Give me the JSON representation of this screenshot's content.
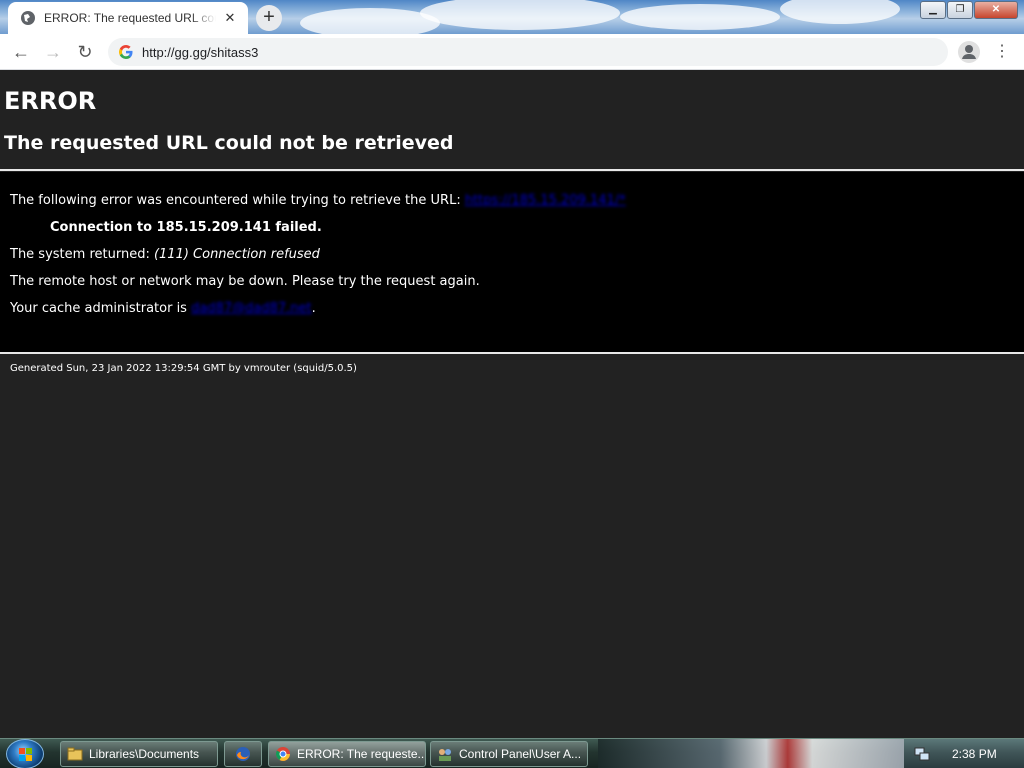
{
  "browser": {
    "tab": {
      "title": "ERROR: The requested URL could not be retrieved",
      "close": "✕"
    },
    "new_tab": "+",
    "window_controls": {
      "minimize": "▁",
      "restore": "❐",
      "close": "✕"
    },
    "toolbar": {
      "back": "←",
      "forward": "→",
      "reload": "↻",
      "menu": "⋮"
    },
    "address_bar": {
      "url": "http://gg.gg/shitass3"
    }
  },
  "page": {
    "heading": "ERROR",
    "subheading": "The requested URL could not be retrieved",
    "error_intro": "The following error was encountered while trying to retrieve the URL: ",
    "error_url": "https://185.15.209.141/*",
    "connection_failed": "Connection to 185.15.209.141 failed.",
    "system_returned_label": "The system returned: ",
    "system_returned_value": "(111) Connection refused",
    "remote_host_msg": "The remote host or network may be down. Please try the request again.",
    "admin_label": "Your cache administrator is ",
    "admin_email": "dad87@dad87.net",
    "admin_suffix": ".",
    "footer": "Generated Sun, 23 Jan 2022 13:29:54 GMT by vmrouter (squid/5.0.5)"
  },
  "taskbar": {
    "tasks": [
      {
        "label": "Libraries\\Documents",
        "icon": "folder-icon"
      },
      {
        "label": "",
        "icon": "firefox-icon"
      },
      {
        "label": "ERROR: The requeste...",
        "icon": "chrome-icon"
      },
      {
        "label": "Control Panel\\User A...",
        "icon": "control-panel-icon"
      }
    ],
    "clock": "2:38 PM"
  },
  "colors": {
    "page_bg": "#222222",
    "error_block_bg": "#000000",
    "link": "#0000cc",
    "text": "#ffffff"
  }
}
